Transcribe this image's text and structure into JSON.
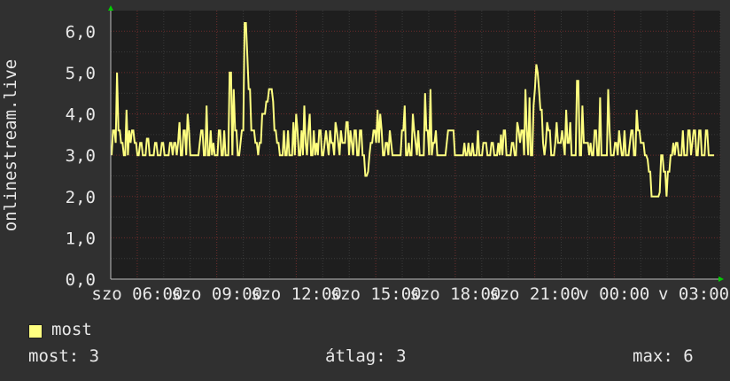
{
  "chart_data": {
    "type": "line",
    "ylabel": "onlinestream.live",
    "ylim": [
      0,
      6.5
    ],
    "y_ticks": [
      "0,0",
      "1,0",
      "2,0",
      "3,0",
      "4,0",
      "5,0",
      "6,0"
    ],
    "x_tick_labels": [
      "szo 06:00",
      "szo 09:00",
      "szo 12:00",
      "szo 15:00",
      "szo 18:00",
      "szo 21:00",
      "v 00:00",
      "v 03:00"
    ],
    "x_range": [
      0,
      23
    ],
    "series": [
      {
        "name": "most",
        "color": "#ffff80",
        "values": [
          3.0,
          3.6,
          3.6,
          3.3,
          5.0,
          3.6,
          3.6,
          3.3,
          3.3,
          3.0,
          3.0,
          4.1,
          3.0,
          3.6,
          3.3,
          3.6,
          3.6,
          3.3,
          3.3,
          3.0,
          3.0,
          3.3,
          3.3,
          3.0,
          3.0,
          3.0,
          3.4,
          3.4,
          3.0,
          3.0,
          3.0,
          3.0,
          3.3,
          3.3,
          3.0,
          3.0,
          3.0,
          3.3,
          3.3,
          3.0,
          3.0,
          3.0,
          3.0,
          3.3,
          3.3,
          3.0,
          3.3,
          3.3,
          3.0,
          3.3,
          3.8,
          3.0,
          3.0,
          3.6,
          3.6,
          3.0,
          4.0,
          3.6,
          3.0,
          3.0,
          3.0,
          3.0,
          3.0,
          3.0,
          3.0,
          3.3,
          3.6,
          3.6,
          3.0,
          3.0,
          4.2,
          3.0,
          3.0,
          3.6,
          3.0,
          3.3,
          3.0,
          3.0,
          3.0,
          3.6,
          3.6,
          3.0,
          3.0,
          3.6,
          3.0,
          3.0,
          3.0,
          5.0,
          5.0,
          3.0,
          4.6,
          3.6,
          3.6,
          3.0,
          3.0,
          3.3,
          3.6,
          3.6,
          6.2,
          6.2,
          5.4,
          4.6,
          4.6,
          3.6,
          3.6,
          3.6,
          3.3,
          3.3,
          3.0,
          3.3,
          3.3,
          4.0,
          4.0,
          4.0,
          4.3,
          4.3,
          4.6,
          4.6,
          4.6,
          4.3,
          3.6,
          3.6,
          3.3,
          3.3,
          3.0,
          3.0,
          3.0,
          3.6,
          3.0,
          3.0,
          3.6,
          3.0,
          3.0,
          3.0,
          3.8,
          3.0,
          4.0,
          3.6,
          3.0,
          3.0,
          3.6,
          3.0,
          4.2,
          3.3,
          3.0,
          3.6,
          4.0,
          3.0,
          3.0,
          3.6,
          3.0,
          3.3,
          3.0,
          3.6,
          3.6,
          3.0,
          3.0,
          3.3,
          3.6,
          3.3,
          3.0,
          3.6,
          3.3,
          3.3,
          3.0,
          3.8,
          3.6,
          3.3,
          3.0,
          3.6,
          3.3,
          3.3,
          3.3,
          3.8,
          3.8,
          3.0,
          3.6,
          3.3,
          3.0,
          3.6,
          3.6,
          3.0,
          3.0,
          3.6,
          3.6,
          3.0,
          3.0,
          2.5,
          2.5,
          2.6,
          3.0,
          3.3,
          3.3,
          3.6,
          3.6,
          3.3,
          4.1,
          3.3,
          4.0,
          3.6,
          3.0,
          3.0,
          3.3,
          3.3,
          3.0,
          3.6,
          3.3,
          3.0,
          3.0,
          3.0,
          3.0,
          3.0,
          3.0,
          3.0,
          3.6,
          3.6,
          4.2,
          3.0,
          3.0,
          3.3,
          3.0,
          3.0,
          4.0,
          3.6,
          3.3,
          3.0,
          3.6,
          3.0,
          3.0,
          3.0,
          3.0,
          4.5,
          3.6,
          3.6,
          3.0,
          4.6,
          3.0,
          3.3,
          3.3,
          3.6,
          3.0,
          3.0,
          3.0,
          3.0,
          3.0,
          3.0,
          3.0,
          3.3,
          3.6,
          3.6,
          3.6,
          3.6,
          3.6,
          3.0,
          3.0,
          3.0,
          3.0,
          3.0,
          3.0,
          3.0,
          3.3,
          3.0,
          3.0,
          3.3,
          3.0,
          3.0,
          3.3,
          3.0,
          3.0,
          3.0,
          3.6,
          3.0,
          3.0,
          3.0,
          3.3,
          3.3,
          3.3,
          3.0,
          3.0,
          3.0,
          3.3,
          3.3,
          3.0,
          3.0,
          3.0,
          3.3,
          3.0,
          3.5,
          3.0,
          3.6,
          3.6,
          3.0,
          3.0,
          3.0,
          3.0,
          3.3,
          3.3,
          3.0,
          3.0,
          3.8,
          3.6,
          3.3,
          3.6,
          3.6,
          3.0,
          4.6,
          3.6,
          3.0,
          4.4,
          3.0,
          3.0,
          4.2,
          4.6,
          5.2,
          5.0,
          4.6,
          4.1,
          4.1,
          3.3,
          3.0,
          3.3,
          3.8,
          3.6,
          3.6,
          3.0,
          3.0,
          3.0,
          3.3,
          3.8,
          3.3,
          3.3,
          3.3,
          3.6,
          3.3,
          3.0,
          4.1,
          3.3,
          3.3,
          3.8,
          3.0,
          3.0,
          3.0,
          3.0,
          4.8,
          4.8,
          3.0,
          3.0,
          4.2,
          3.3,
          3.3,
          3.3,
          3.3,
          3.0,
          3.3,
          3.0,
          3.0,
          3.6,
          3.6,
          3.0,
          3.0,
          4.4,
          3.0,
          3.0,
          3.0,
          3.0,
          3.0,
          4.6,
          3.6,
          3.0,
          3.0,
          3.0,
          3.3,
          3.3,
          3.0,
          3.6,
          3.3,
          3.0,
          3.0,
          3.6,
          3.0,
          3.0,
          3.0,
          3.3,
          3.6,
          3.6,
          3.0,
          3.0,
          4.1,
          3.6,
          3.6,
          3.3,
          3.3,
          3.3,
          3.0,
          3.0,
          2.9,
          2.6,
          2.6,
          2.0,
          2.0,
          2.0,
          2.0,
          2.0,
          2.0,
          2.1,
          3.0,
          3.0,
          2.6,
          2.6,
          2.0,
          2.6,
          2.6,
          3.0,
          3.0,
          3.3,
          3.0,
          3.3,
          3.3,
          3.0,
          3.0,
          3.0,
          3.6,
          3.0,
          3.0,
          3.0,
          3.6,
          3.6,
          3.0,
          3.3,
          3.6,
          3.6,
          3.0,
          3.0,
          3.6,
          3.6,
          3.0,
          3.0,
          3.0,
          3.6,
          3.6,
          3.0,
          3.0,
          3.0,
          3.0,
          3.0
        ]
      }
    ],
    "grid": true
  },
  "legend": {
    "swatch_color": "#ffff80",
    "label": "most"
  },
  "stats": {
    "now": "most: 3",
    "avg": "átlag: 3",
    "max": "max: 6"
  }
}
